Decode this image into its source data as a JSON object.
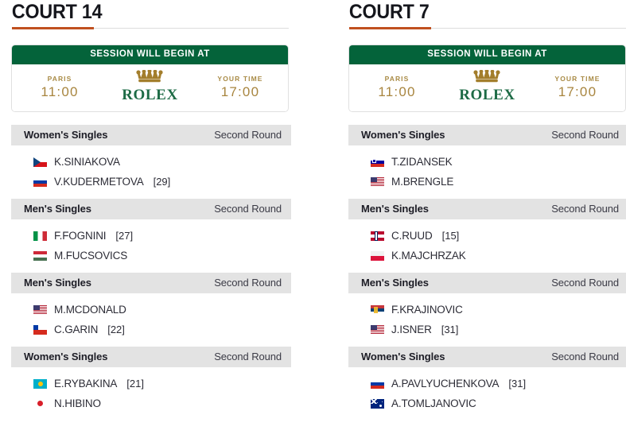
{
  "courts": [
    {
      "title": "COURT 14",
      "session": {
        "banner": "SESSION WILL BEGIN AT",
        "paris_label": "PARIS",
        "paris_time": "11:00",
        "your_label": "YOUR TIME",
        "your_time": "17:00",
        "sponsor": "ROLEX"
      },
      "matches": [
        {
          "event": "Women's Singles",
          "round": "Second Round",
          "players": [
            {
              "flag": "cz",
              "flag_name": "flag-czech-republic",
              "name": "K.SINIAKOVA",
              "seed": ""
            },
            {
              "flag": "ru",
              "flag_name": "flag-russia",
              "name": "V.KUDERMETOVA",
              "seed": "[29]"
            }
          ]
        },
        {
          "event": "Men's Singles",
          "round": "Second Round",
          "players": [
            {
              "flag": "it",
              "flag_name": "flag-italy",
              "name": "F.FOGNINI",
              "seed": "[27]"
            },
            {
              "flag": "hu",
              "flag_name": "flag-hungary",
              "name": "M.FUCSOVICS",
              "seed": ""
            }
          ]
        },
        {
          "event": "Men's Singles",
          "round": "Second Round",
          "players": [
            {
              "flag": "us",
              "flag_name": "flag-united-states",
              "name": "M.MCDONALD",
              "seed": ""
            },
            {
              "flag": "cl",
              "flag_name": "flag-chile",
              "name": "C.GARIN",
              "seed": "[22]"
            }
          ]
        },
        {
          "event": "Women's Singles",
          "round": "Second Round",
          "players": [
            {
              "flag": "kz",
              "flag_name": "flag-kazakhstan",
              "name": "E.RYBAKINA",
              "seed": "[21]"
            },
            {
              "flag": "jp",
              "flag_name": "flag-japan",
              "name": "N.HIBINO",
              "seed": ""
            }
          ]
        }
      ]
    },
    {
      "title": "COURT 7",
      "session": {
        "banner": "SESSION WILL BEGIN AT",
        "paris_label": "PARIS",
        "paris_time": "11:00",
        "your_label": "YOUR TIME",
        "your_time": "17:00",
        "sponsor": "ROLEX"
      },
      "matches": [
        {
          "event": "Women's Singles",
          "round": "Second Round",
          "players": [
            {
              "flag": "si",
              "flag_name": "flag-slovenia",
              "name": "T.ZIDANSEK",
              "seed": ""
            },
            {
              "flag": "us",
              "flag_name": "flag-united-states",
              "name": "M.BRENGLE",
              "seed": ""
            }
          ]
        },
        {
          "event": "Men's Singles",
          "round": "Second Round",
          "players": [
            {
              "flag": "no",
              "flag_name": "flag-norway",
              "name": "C.RUUD",
              "seed": "[15]"
            },
            {
              "flag": "pl",
              "flag_name": "flag-poland",
              "name": "K.MAJCHRZAK",
              "seed": ""
            }
          ]
        },
        {
          "event": "Men's Singles",
          "round": "Second Round",
          "players": [
            {
              "flag": "rs",
              "flag_name": "flag-serbia",
              "name": "F.KRAJINOVIC",
              "seed": ""
            },
            {
              "flag": "us",
              "flag_name": "flag-united-states",
              "name": "J.ISNER",
              "seed": "[31]"
            }
          ]
        },
        {
          "event": "Women's Singles",
          "round": "Second Round",
          "players": [
            {
              "flag": "ru",
              "flag_name": "flag-russia",
              "name": "A.PAVLYUCHENKOVA",
              "seed": "[31]"
            },
            {
              "flag": "au",
              "flag_name": "flag-australia",
              "name": "A.TOMLJANOVIC",
              "seed": ""
            }
          ]
        }
      ]
    }
  ],
  "colors": {
    "accent_underline": "#c0501f",
    "banner_green": "#04633a",
    "gold": "#a8853f",
    "rolex_green": "#1d6b45",
    "section_header_bg": "#e3e3e3"
  }
}
